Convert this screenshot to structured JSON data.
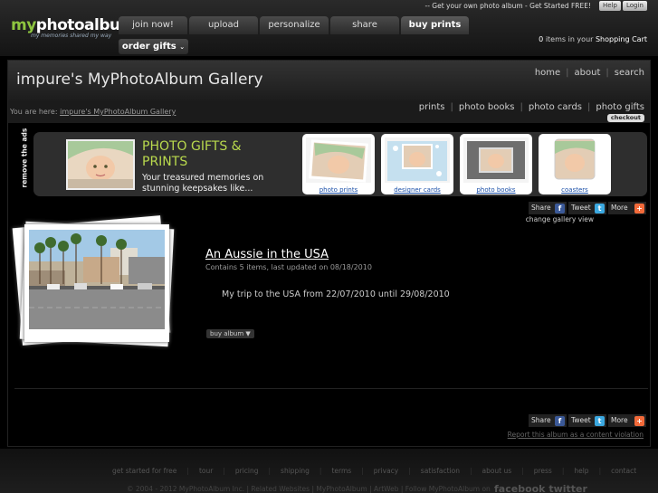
{
  "brand": {
    "logo_prefix": "my",
    "logo_rest": "photoalbum",
    "tagline": "my memories shared my way"
  },
  "header": {
    "promo": "-- Get your own photo album - Get Started FREE!",
    "help": "Help",
    "login": "Login",
    "nav": [
      "join now!",
      "upload",
      "personalize",
      "share",
      "buy prints"
    ],
    "subnav": "order gifts",
    "cart_count": "0",
    "cart_mid": "items in your",
    "cart_link": "Shopping Cart"
  },
  "gallery": {
    "title": "impure's MyPhotoAlbum Gallery",
    "top_links": [
      "home",
      "about",
      "search"
    ],
    "breadcrumb_prefix": "You are here:",
    "breadcrumb_link": "impure's MyPhotoAlbum Gallery",
    "product_links": [
      "prints",
      "photo books",
      "photo cards",
      "photo gifts"
    ],
    "checkout": "checkout"
  },
  "ad": {
    "remove": "remove the ads",
    "headline": "PHOTO GIFTS & PRINTS",
    "sub": "Your treasured memories on stunning keepsakes like...",
    "products": [
      "photo prints",
      "designer cards",
      "photo books",
      "coasters"
    ]
  },
  "share": {
    "share": "Share",
    "tweet": "Tweet",
    "more": "More",
    "change_view": "change gallery view"
  },
  "album": {
    "title": "An Aussie in the USA",
    "meta": "Contains 5 items, last updated on 08/18/2010",
    "description": "My trip to the USA from 22/07/2010 until 29/08/2010",
    "buy": "buy album ▼"
  },
  "report": "Report this album as a content violation",
  "footer": {
    "links": [
      "get started for free",
      "tour",
      "pricing",
      "shipping",
      "terms",
      "privacy",
      "satisfaction",
      "about us",
      "press",
      "help",
      "contact"
    ],
    "copyright": "© 2004 - 2012 MyPhotoAlbum Inc.  |  Related Websites  |  MyPhotoAlbum  |  ArtWeb  |  Follow MyPhotoAlbum on",
    "social": "facebook  twitter"
  },
  "colors": {
    "accent_green": "#b9d94d",
    "link_blue": "#1a4fa8",
    "background": "#000000"
  }
}
